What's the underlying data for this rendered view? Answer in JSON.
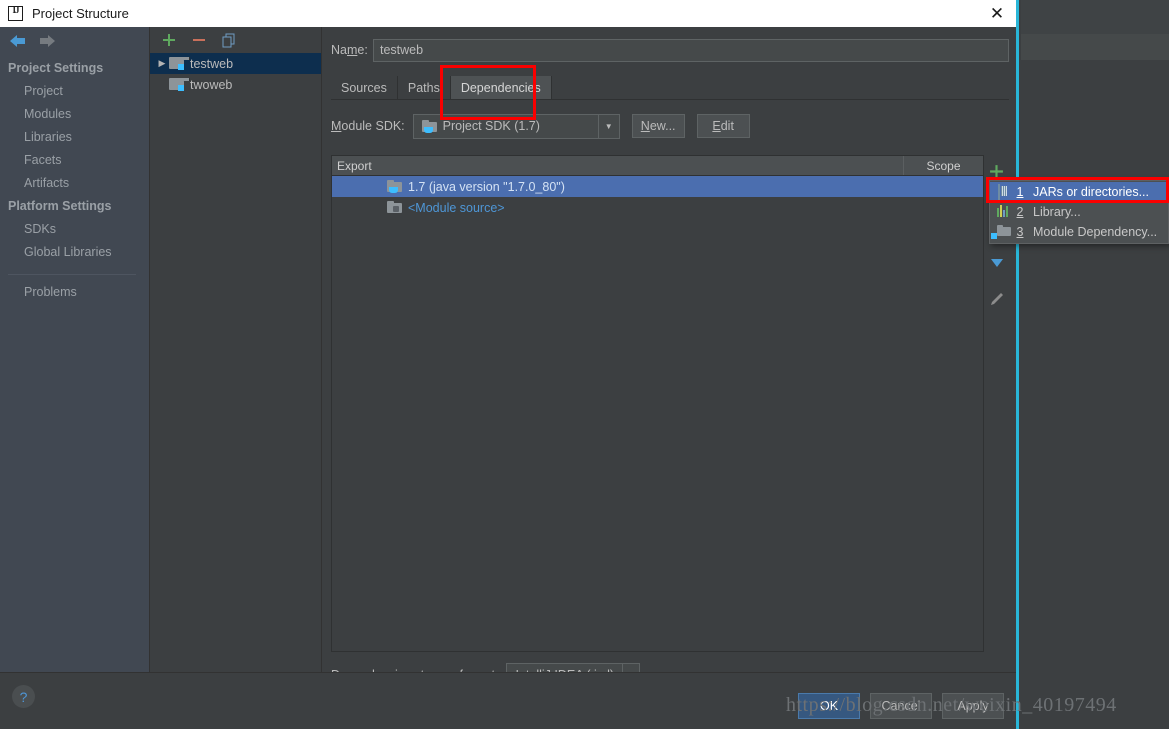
{
  "window": {
    "title": "Project Structure",
    "app_icon": "intellij-idea-icon",
    "close_icon": "close-icon"
  },
  "sidebar": {
    "back_icon": "back-arrow-icon",
    "forward_icon": "forward-arrow-icon",
    "groups": [
      {
        "label": "Project Settings",
        "items": [
          {
            "label": "Project"
          },
          {
            "label": "Modules"
          },
          {
            "label": "Libraries"
          },
          {
            "label": "Facets"
          },
          {
            "label": "Artifacts"
          }
        ]
      },
      {
        "label": "Platform Settings",
        "items": [
          {
            "label": "SDKs"
          },
          {
            "label": "Global Libraries"
          }
        ]
      }
    ],
    "extra": [
      {
        "label": "Problems"
      }
    ]
  },
  "modules_panel": {
    "toolbar": {
      "add_icon": "plus-icon",
      "remove_icon": "minus-icon",
      "copy_icon": "copy-icon"
    },
    "items": [
      {
        "label": "testweb",
        "selected": true,
        "expandable": true
      },
      {
        "label": "twoweb",
        "selected": false,
        "expandable": false
      }
    ]
  },
  "module_editor": {
    "name_label": "Name:",
    "name_value": "testweb",
    "tabs": [
      {
        "label": "Sources",
        "active": false
      },
      {
        "label": "Paths",
        "active": false
      },
      {
        "label": "Dependencies",
        "active": true
      }
    ],
    "sdk_label": "Module SDK:",
    "sdk_value": "Project SDK (1.7)",
    "new_button": "New...",
    "edit_button": "Edit",
    "table": {
      "columns": [
        "Export",
        "Scope"
      ],
      "rows": [
        {
          "name": "1.7 (java version \"1.7.0_80\")",
          "scope": "",
          "icon": "sdk-folder-icon",
          "selected": true
        },
        {
          "name": "<Module source>",
          "scope": "",
          "icon": "module-source-icon",
          "selected": false
        }
      ]
    },
    "rail": {
      "add_icon": "plus-icon",
      "move_down_icon": "arrow-down-icon",
      "edit_icon": "pencil-icon"
    },
    "storage_label": "Dependencies storage format:",
    "storage_value": "IntelliJ IDEA (.iml)"
  },
  "add_dependency_menu": {
    "items": [
      {
        "mnemonic": "1",
        "label": "JARs or directories...",
        "icon": "jar-icon",
        "highlighted": true
      },
      {
        "mnemonic": "2",
        "label": "Library...",
        "icon": "library-icon",
        "highlighted": false
      },
      {
        "mnemonic": "3",
        "label": "Module Dependency...",
        "icon": "module-folder-icon",
        "highlighted": false
      }
    ]
  },
  "footer": {
    "help_label": "?",
    "ok_label": "OK",
    "cancel_label": "Cancel",
    "apply_label": "Apply"
  },
  "watermark": {
    "text": "https://blog.csdn.net/weixin_40197494"
  },
  "colors": {
    "accent_blue": "#4b6eaf",
    "selection_navy": "#0d2e4e",
    "link_blue": "#4e96d6",
    "annotation_red": "#fb0000",
    "primary_button": "#365880",
    "dialog_bg": "#3c3f41",
    "sidebar_bg": "#414852",
    "edge_cyan": "#29b6d8"
  }
}
